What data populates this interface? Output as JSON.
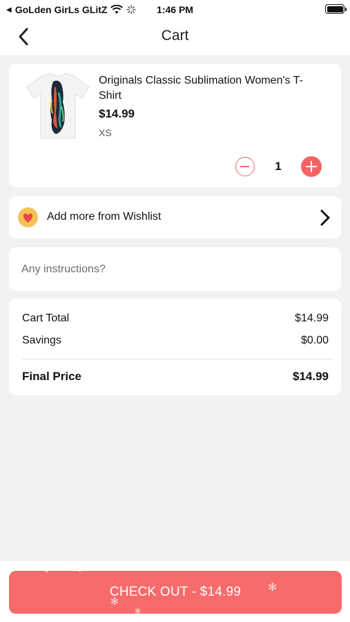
{
  "status_bar": {
    "carrier": "GoLden GirLs GLitZ",
    "time": "1:46 PM",
    "icons": [
      "back-triangle-icon",
      "wifi-icon",
      "activity-spinner-icon",
      "battery-icon"
    ]
  },
  "nav": {
    "title": "Cart",
    "back_icon": "chevron-left-icon"
  },
  "cart_items": [
    {
      "name": "Originals Classic Sublimation Women's T-Shirt",
      "price": "$14.99",
      "size": "XS",
      "quantity": "1",
      "image_icon": "tshirt-image"
    }
  ],
  "wishlist": {
    "label": "Add more from Wishlist",
    "icon": "heart-icon",
    "chevron": "chevron-right-icon"
  },
  "instructions": {
    "placeholder": "Any instructions?",
    "value": ""
  },
  "totals": {
    "cart_total_label": "Cart Total",
    "cart_total_value": "$14.99",
    "savings_label": "Savings",
    "savings_value": "$0.00",
    "final_label": "Final Price",
    "final_value": "$14.99"
  },
  "checkout": {
    "label": "CHECK OUT - $14.99"
  },
  "colors": {
    "accent": "#f76b6b",
    "background": "#f2f2f2",
    "card": "#ffffff",
    "wishlist_badge": "#f4c256"
  }
}
